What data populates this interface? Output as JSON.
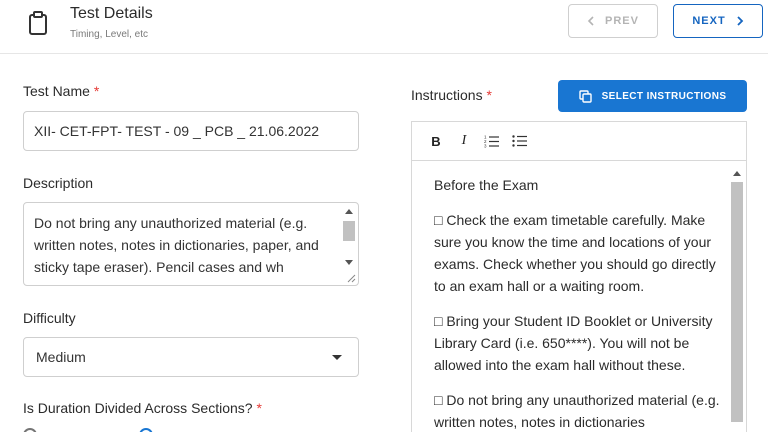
{
  "header": {
    "title": "Test Details",
    "subtitle": "Timing, Level, etc",
    "prev_label": "PREV",
    "next_label": "NEXT"
  },
  "form": {
    "test_name": {
      "label": "Test Name",
      "required": "*",
      "value": "XII- CET-FPT- TEST - 09 _ PCB _ 21.06.2022"
    },
    "description": {
      "label": "Description",
      "value": "Do not bring any unauthorized material (e.g. written notes, notes in dictionaries, paper, and sticky tape eraser). Pencil cases and wh"
    },
    "difficulty": {
      "label": "Difficulty",
      "value": "Medium"
    },
    "duration_divided": {
      "label": "Is Duration Divided Across Sections?",
      "required": "*"
    }
  },
  "instructions": {
    "label": "Instructions",
    "required": "*",
    "select_label": "SELECT INSTRUCTIONS",
    "toolbar": {
      "bold": "B",
      "italic": "I"
    },
    "paragraphs": [
      "Before the Exam",
      "□ Check the exam timetable carefully. Make sure you know the time and locations of your exams. Check whether you should go directly to an exam hall or a waiting room.",
      "□ Bring your Student ID Booklet or University Library Card (i.e. 650****). You will not be allowed into the exam hall without these.",
      "□ Do not bring any unauthorized material (e.g. written notes, notes in dictionaries"
    ]
  },
  "colors": {
    "primary": "#1976d2",
    "required": "#e53935",
    "disabled": "#b4b4b4"
  },
  "icons": {
    "header": "clipboard-icon",
    "prev": "chevron-left-icon",
    "next": "chevron-right-icon",
    "select": "copy-icon",
    "dropdown": "caret-down-icon"
  }
}
